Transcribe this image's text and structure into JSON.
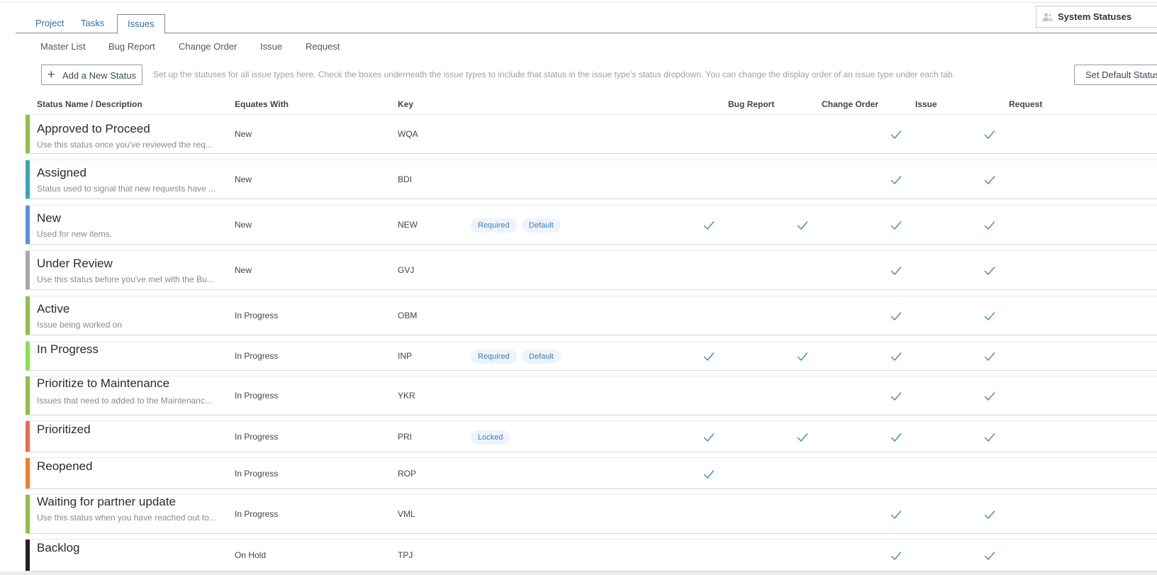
{
  "tabs": [
    {
      "label": "Project",
      "active": false
    },
    {
      "label": "Tasks",
      "active": false
    },
    {
      "label": "Issues",
      "active": true
    }
  ],
  "system_status_selector": {
    "label": "System Statuses",
    "icon": "users-icon"
  },
  "subnav": [
    "Master List",
    "Bug Report",
    "Change Order",
    "Issue",
    "Request"
  ],
  "actions": {
    "add_status_label": "Add a New Status",
    "help_text": "Set up the statuses for all issue types here. Check the boxes underneath the issue types to include that status in the issue type's status dropdown. You can change the display order of an issue type under each tab.",
    "set_default_label": "Set Default Statuses"
  },
  "columns": {
    "name": "Status Name / Description",
    "equates": "Equates With",
    "key": "Key",
    "bug_report": "Bug Report",
    "change_order": "Change Order",
    "issue": "Issue",
    "request": "Request"
  },
  "rows": [
    {
      "name": "Approved to Proceed",
      "desc": "Use this status once you've reviewed the req...",
      "equates": "New",
      "key": "WQA",
      "badges": [],
      "bug": false,
      "change": false,
      "issue": true,
      "request": true,
      "color": "#8cc04a"
    },
    {
      "name": "Assigned",
      "desc": "Status used to signal that new requests have ...",
      "equates": "New",
      "key": "BDI",
      "badges": [],
      "bug": false,
      "change": false,
      "issue": true,
      "request": true,
      "color": "#3aa6b9"
    },
    {
      "name": "New",
      "desc": "Used for new items.",
      "equates": "New",
      "key": "NEW",
      "badges": [
        "Required",
        "Default"
      ],
      "bug": true,
      "change": true,
      "issue": true,
      "request": true,
      "color": "#5b8fe6"
    },
    {
      "name": "Under Review",
      "desc": "Use this status before you've met with the Bu...",
      "equates": "New",
      "key": "GVJ",
      "badges": [],
      "bug": false,
      "change": false,
      "issue": true,
      "request": true,
      "color": "#a8a8a0"
    },
    {
      "name": "Active",
      "desc": "Issue being worked on",
      "equates": "In Progress",
      "key": "OBM",
      "badges": [],
      "bug": false,
      "change": false,
      "issue": true,
      "request": true,
      "color": "#8cc04a"
    },
    {
      "name": "In Progress",
      "desc": "",
      "equates": "In Progress",
      "key": "INP",
      "badges": [
        "Required",
        "Default"
      ],
      "bug": true,
      "change": true,
      "issue": true,
      "request": true,
      "color": "#7ee84a"
    },
    {
      "name": "Prioritize to Maintenance",
      "desc": "Issues that need to added to the Maintenanc...",
      "equates": "In Progress",
      "key": "YKR",
      "badges": [],
      "bug": false,
      "change": false,
      "issue": true,
      "request": true,
      "color": "#8cc04a"
    },
    {
      "name": "Prioritized",
      "desc": "",
      "equates": "In Progress",
      "key": "PRI",
      "badges": [
        "Locked"
      ],
      "bug": true,
      "change": true,
      "issue": true,
      "request": true,
      "color": "#f06a4a"
    },
    {
      "name": "Reopened",
      "desc": "",
      "equates": "In Progress",
      "key": "ROP",
      "badges": [],
      "bug": true,
      "change": false,
      "issue": false,
      "request": false,
      "color": "#f57c2f"
    },
    {
      "name": "Waiting for partner update",
      "desc": "Use this status when you have reached out to...",
      "equates": "In Progress",
      "key": "VML",
      "badges": [],
      "bug": false,
      "change": false,
      "issue": true,
      "request": true,
      "color": "#8cc04a"
    },
    {
      "name": "Backlog",
      "desc": "",
      "equates": "On Hold",
      "key": "TPJ",
      "badges": [],
      "bug": false,
      "change": false,
      "issue": true,
      "request": true,
      "color": "#222222"
    }
  ],
  "icons": {
    "check": "checkmark-icon",
    "plus": "plus-icon"
  },
  "accent_color": "#2f6fb0",
  "check_color": "#3a86cc"
}
